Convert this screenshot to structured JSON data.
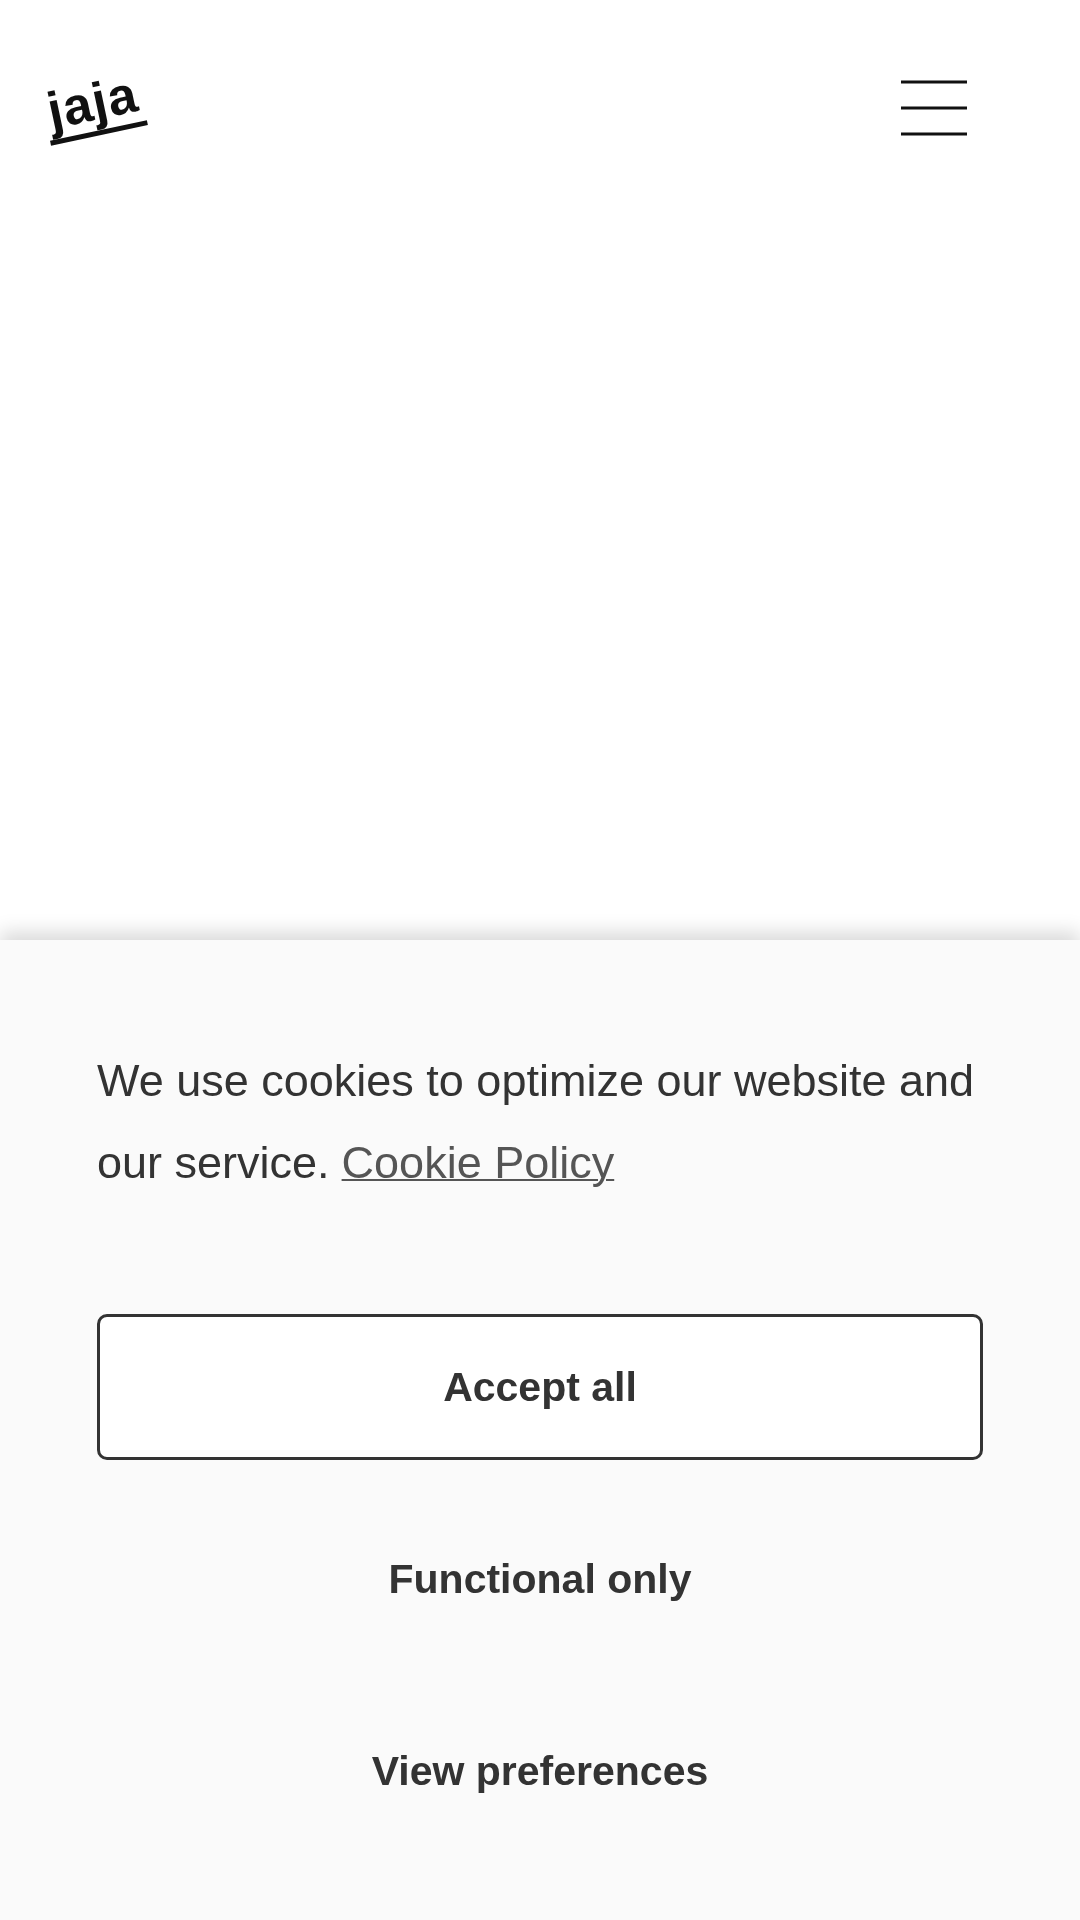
{
  "header": {
    "logo": "jaja"
  },
  "cookie_banner": {
    "message": "We use cookies to optimize our website and our service.",
    "policy_link": "Cookie Policy",
    "buttons": [
      {
        "label": "Accept all",
        "kind": "outlined"
      },
      {
        "label": "Functional only",
        "kind": "plain"
      },
      {
        "label": "View preferences",
        "kind": "plain"
      }
    ]
  }
}
